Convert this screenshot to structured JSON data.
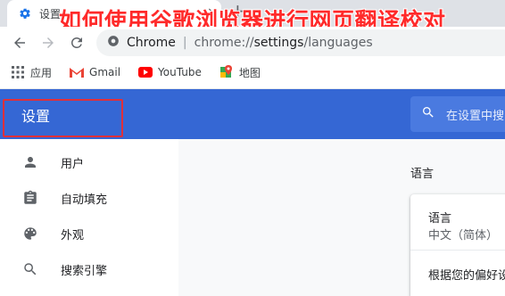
{
  "overlay_title": "如何使用谷歌浏览器进行网页翻译校对",
  "browser": {
    "tab": {
      "title": "设置",
      "icon": "gear-icon",
      "close_label": "×"
    },
    "new_tab_label": "+",
    "omnibox": {
      "site_label": "Chrome",
      "separator": "|",
      "url_host": "chrome://",
      "url_path_strong": "settings",
      "url_rest": "/languages"
    }
  },
  "bookmarks": [
    {
      "label": "应用",
      "icon": "apps-grid-icon"
    },
    {
      "label": "Gmail",
      "icon": "gmail-icon"
    },
    {
      "label": "YouTube",
      "icon": "youtube-icon"
    },
    {
      "label": "地图",
      "icon": "maps-icon"
    }
  ],
  "settings": {
    "title": "设置",
    "search_placeholder": "在设置中搜",
    "sidebar": [
      {
        "label": "用户",
        "icon": "person-icon"
      },
      {
        "label": "自动填充",
        "icon": "clipboard-icon"
      },
      {
        "label": "外观",
        "icon": "palette-icon"
      },
      {
        "label": "搜索引擎",
        "icon": "search-icon"
      }
    ],
    "section_title": "语言",
    "card": {
      "heading": "语言",
      "subtitle": "中文（简体）",
      "text": "根据您的偏好设"
    }
  },
  "colors": {
    "header_blue": "#3567d4",
    "highlight_red": "#e0303a",
    "title_red": "#ff2a2a"
  }
}
